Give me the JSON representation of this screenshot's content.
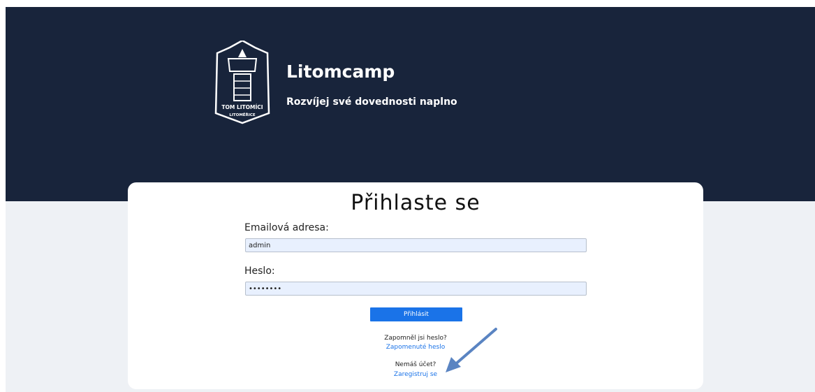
{
  "brand": {
    "title": "Litomcamp",
    "subtitle": "Rozvíjej své dovednosti naplno",
    "logo_text_line1": "TOM LITOMÍCI",
    "logo_text_line2": "LITOMĚŘICE"
  },
  "login": {
    "title": "Přihlaste se",
    "email_label": "Emailová adresa:",
    "email_value": "admin",
    "password_label": "Heslo:",
    "password_value": "12345678",
    "submit_label": "Přihlásit",
    "forgot_prompt": "Zapomněl jsi heslo?",
    "forgot_link": "Zapomenuté heslo",
    "register_prompt": "Nemáš účet?",
    "register_link": "Zaregistruj se"
  },
  "colors": {
    "hero_bg": "#18243b",
    "page_bg": "#eef1f5",
    "accent": "#1a73e8",
    "arrow": "#5a84c2"
  },
  "annotation": {
    "icon": "arrow-icon"
  }
}
